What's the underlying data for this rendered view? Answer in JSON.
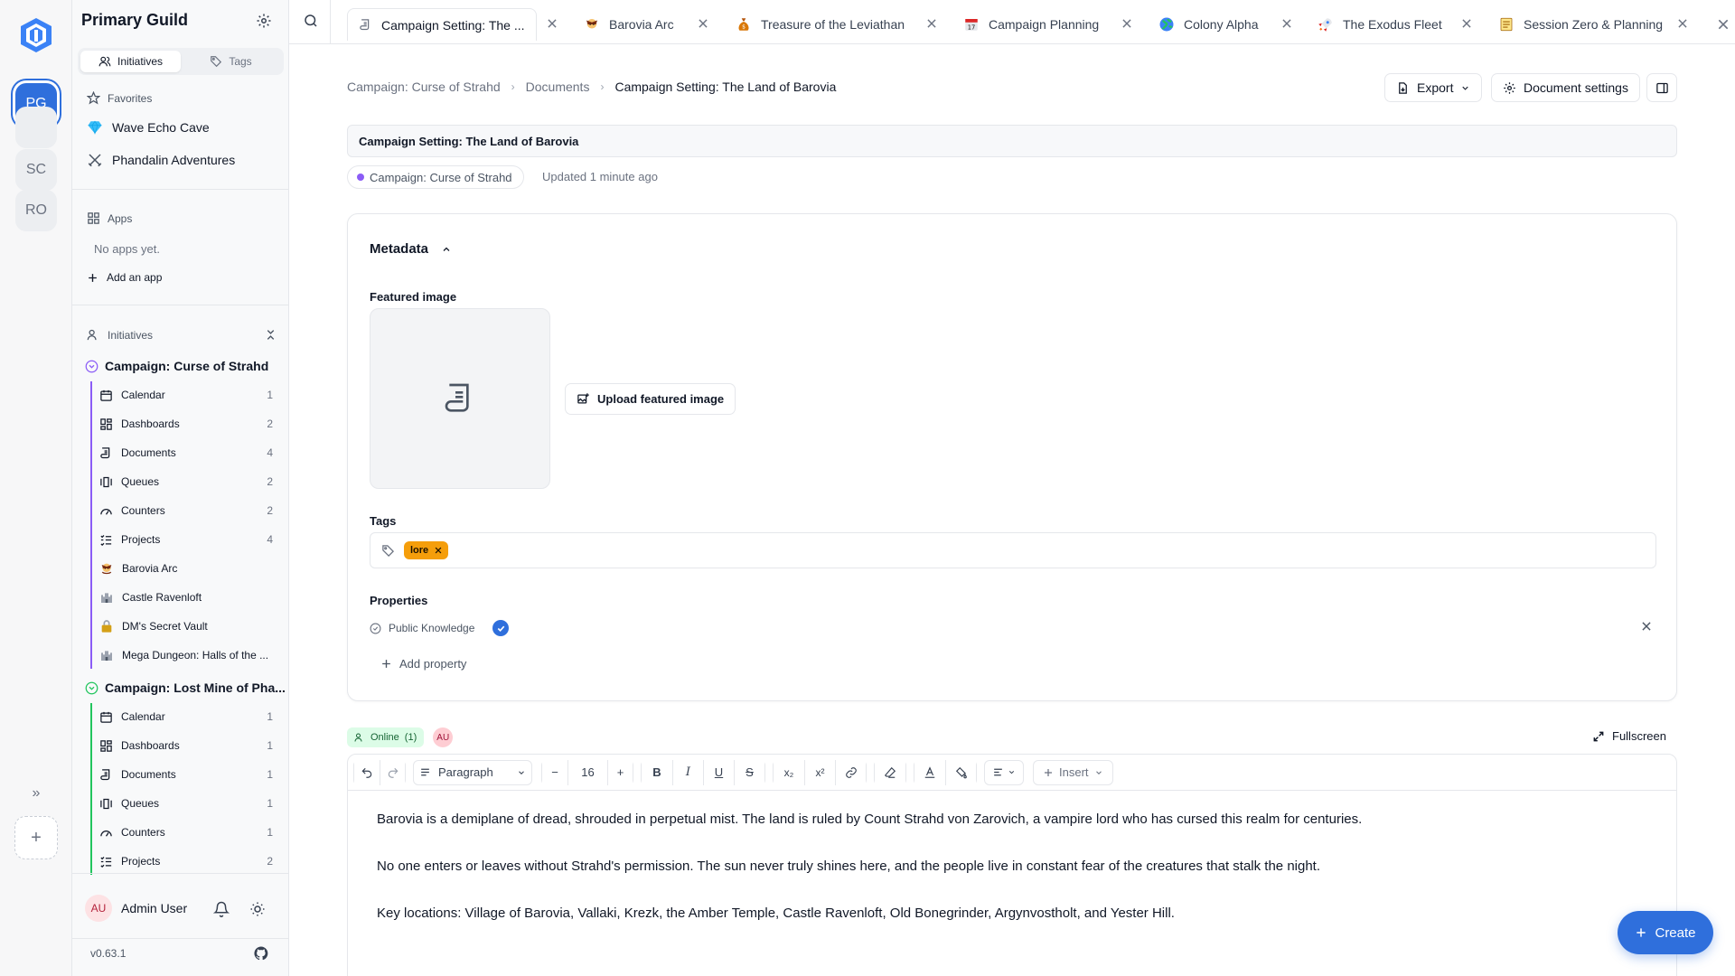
{
  "sidebar": {
    "guild_title": "Primary Guild",
    "seg_initiatives": "Initiatives",
    "seg_tags": "Tags",
    "favorites_label": "Favorites",
    "favorites": [
      {
        "label": "Wave Echo Cave",
        "icon": "gem-icon"
      },
      {
        "label": "Phandalin Adventures",
        "icon": "crossed-swords-icon"
      }
    ],
    "apps_label": "Apps",
    "no_apps": "No apps yet.",
    "add_app": "Add an app",
    "initiatives_label": "Initiatives",
    "initiative1": {
      "title": "Campaign: Curse of Strahd",
      "items": [
        {
          "label": "Calendar",
          "count": "1"
        },
        {
          "label": "Dashboards",
          "count": "2"
        },
        {
          "label": "Documents",
          "count": "4"
        },
        {
          "label": "Queues",
          "count": "2"
        },
        {
          "label": "Counters",
          "count": "2"
        },
        {
          "label": "Projects",
          "count": "4"
        },
        {
          "label": "Barovia Arc",
          "count": ""
        },
        {
          "label": "Castle Ravenloft",
          "count": ""
        },
        {
          "label": "DM's Secret Vault",
          "count": ""
        },
        {
          "label": "Mega Dungeon: Halls of the ...",
          "count": ""
        }
      ]
    },
    "initiative2": {
      "title": "Campaign: Lost Mine of Pha...",
      "items": [
        {
          "label": "Calendar",
          "count": "1"
        },
        {
          "label": "Dashboards",
          "count": "1"
        },
        {
          "label": "Documents",
          "count": "1"
        },
        {
          "label": "Queues",
          "count": "1"
        },
        {
          "label": "Counters",
          "count": "1"
        },
        {
          "label": "Projects",
          "count": "2"
        }
      ]
    },
    "user_initials": "AU",
    "user_name": "Admin User",
    "version": "v0.63.1"
  },
  "rail": {
    "workspaces": [
      "PG",
      "SC",
      "RO"
    ]
  },
  "tabs": [
    {
      "label": "Campaign Setting: The ...",
      "icon": "scroll-icon"
    },
    {
      "label": "Barovia Arc",
      "icon": "vampire-icon"
    },
    {
      "label": "Treasure of the Leviathan",
      "icon": "money-bag-icon"
    },
    {
      "label": "Campaign Planning",
      "icon": "calendar-icon"
    },
    {
      "label": "Colony Alpha",
      "icon": "globe-icon"
    },
    {
      "label": "The Exodus Fleet",
      "icon": "rocket-icon"
    },
    {
      "label": "Session Zero & Planning",
      "icon": "notepad-icon"
    }
  ],
  "breadcrumb": {
    "items": [
      "Campaign: Curse of Strahd",
      "Documents",
      "Campaign Setting: The Land of Barovia"
    ]
  },
  "header": {
    "export_label": "Export",
    "settings_label": "Document settings"
  },
  "document": {
    "title": "Campaign Setting: The Land of Barovia",
    "campaign_chip": "Campaign: Curse of Strahd",
    "updated": "Updated 1 minute ago"
  },
  "metadata": {
    "title": "Metadata",
    "featured_image_label": "Featured image",
    "upload_label": "Upload featured image",
    "tags_label": "Tags",
    "tags": [
      "lore"
    ],
    "properties_label": "Properties",
    "property_name": "Public Knowledge",
    "add_property": "Add property"
  },
  "presence": {
    "online_label": "Online",
    "online_count": "(1)",
    "avatar": "AU",
    "fullscreen_label": "Fullscreen"
  },
  "editor": {
    "block_type": "Paragraph",
    "font_size": "16",
    "insert_label": "Insert",
    "paragraphs": [
      "Barovia is a demiplane of dread, shrouded in perpetual mist. The land is ruled by Count Strahd von Zarovich, a vampire lord who has cursed this realm for centuries.",
      "No one enters or leaves without Strahd's permission. The sun never truly shines here, and the people live in constant fear of the creatures that stalk the night.",
      "Key locations: Village of Barovia, Vallaki, Krezk, the Amber Temple, Castle Ravenloft, Old Bonegrinder, Argynvostholt, and Yester Hill."
    ]
  },
  "create_label": "Create",
  "colors": {
    "accent": "#2f6fdc",
    "tag_lore": "#f59e0b",
    "initiative1": "#8b5cf6",
    "initiative2": "#22c55e"
  }
}
